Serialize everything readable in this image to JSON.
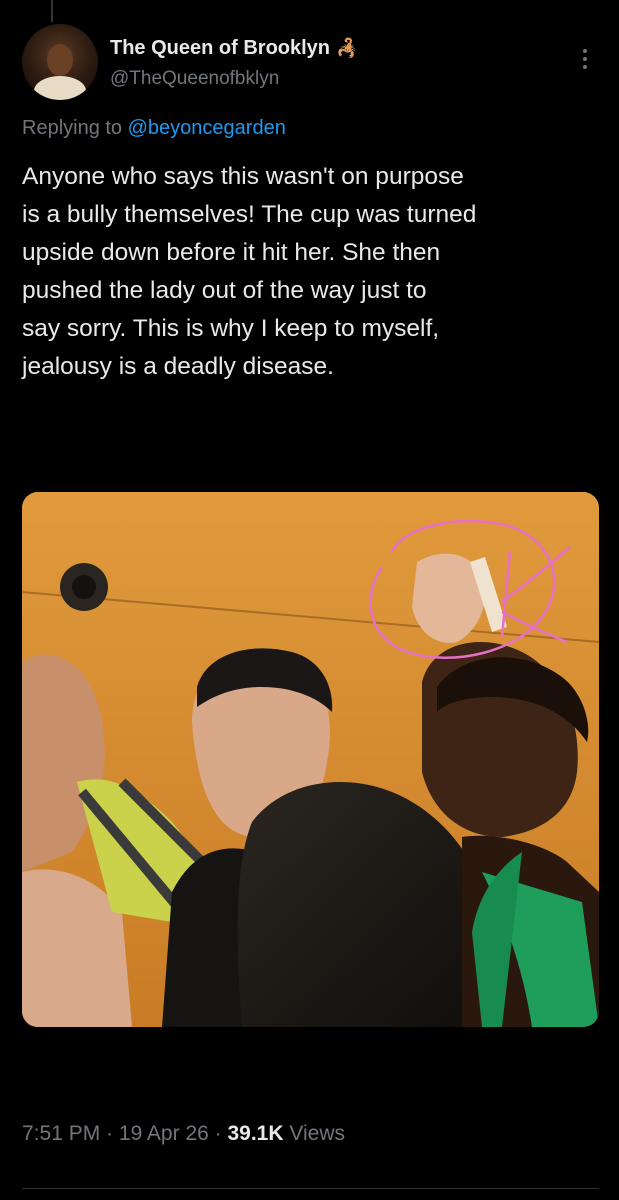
{
  "author": {
    "display_name": "The Queen of Brooklyn",
    "emoji": "🦂",
    "handle": "@TheQueenofbklyn"
  },
  "reply": {
    "prefix": "Replying to",
    "to": "@beyoncegarden"
  },
  "tweet": {
    "lines": [
      "Anyone who says this wasn't on purpose",
      "is a bully themselves! The cup was turned",
      "upside down before it hit her. She then",
      "pushed the lady out of the way just to",
      "say sorry. This is why I keep to myself,",
      "jealousy is a deadly disease."
    ]
  },
  "meta": {
    "time": "7:51 PM",
    "sep1": " · ",
    "date": "19 Apr 26",
    "sep2": " · ",
    "views_count": "39.1K",
    "views_label": "Views"
  },
  "colors": {
    "background": "#000000",
    "text": "#e7e9ea",
    "muted": "#71767b",
    "link": "#1d9bf0"
  }
}
